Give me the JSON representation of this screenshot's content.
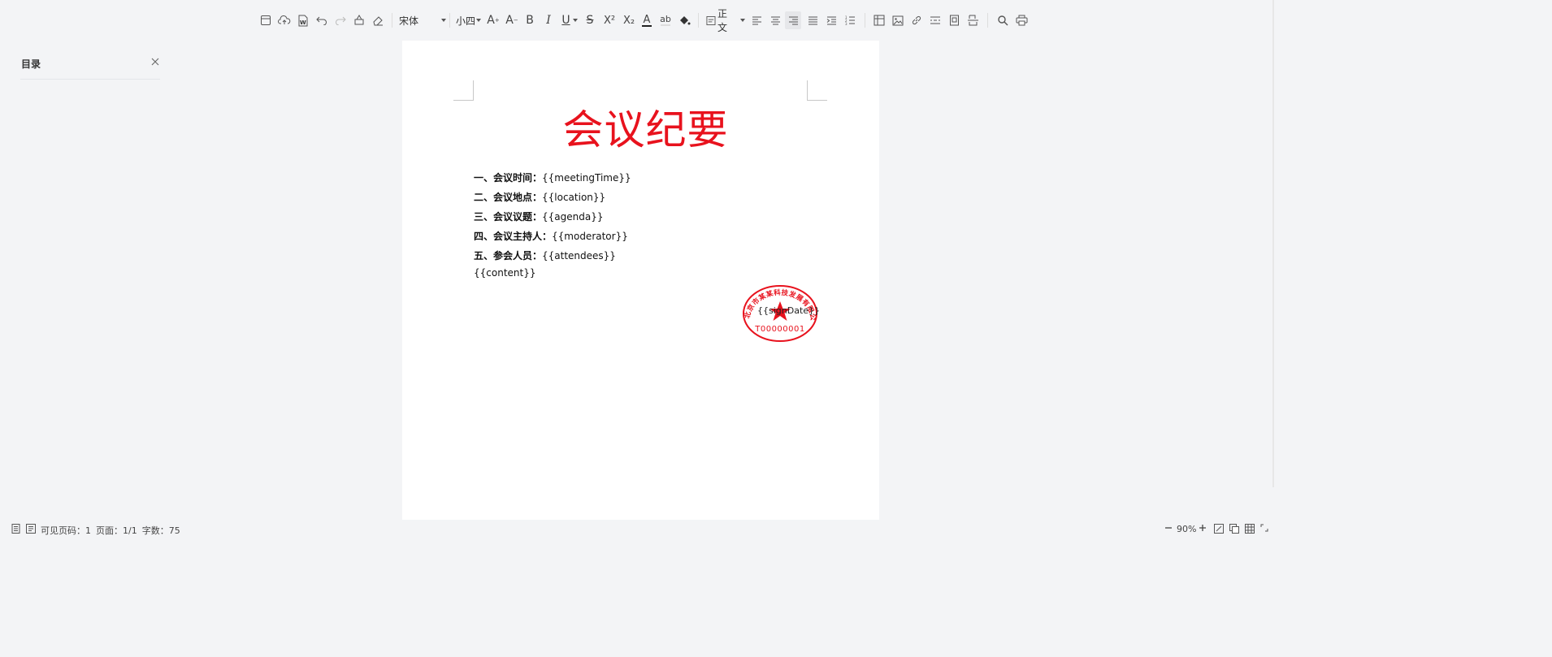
{
  "toolbar": {
    "font_family": "宋体",
    "font_size": "小四",
    "paragraph_style": "正文",
    "bold_glyph": "B",
    "italic_glyph": "I",
    "underline_glyph": "U",
    "strike_glyph": "S",
    "superscript_glyph": "X²",
    "subscript_glyph": "X₂",
    "font_color_glyph": "A",
    "highlight_glyph": "ab"
  },
  "sidebar": {
    "title": "目录"
  },
  "document": {
    "title": "会议纪要",
    "lines": [
      {
        "label": "一、会议时间：",
        "value": "{{meetingTime}}"
      },
      {
        "label": "二、会议地点：",
        "value": "{{location}}"
      },
      {
        "label": "三、会议议题：",
        "value": "{{agenda}}"
      },
      {
        "label": "四、会议主持人：",
        "value": "{{moderator}}"
      },
      {
        "label": "五、参会人员：",
        "value": "{{attendees}}"
      }
    ],
    "content": "{{content}}",
    "seal": {
      "company": "北京市某某科技发展有限公司",
      "code": "T00000001",
      "overlay_text": "{{signDate}}",
      "color": "#e8121d"
    }
  },
  "status": {
    "visible_pages_label": "可见页码：",
    "visible_pages": "1",
    "page_label": "页面：",
    "page": "1/1",
    "word_count_label": "字数：",
    "word_count": "75",
    "zoom": "90%"
  },
  "colors": {
    "accent_red": "#e8121d",
    "page_bg": "#ffffff",
    "app_bg": "#f3f4f6"
  }
}
